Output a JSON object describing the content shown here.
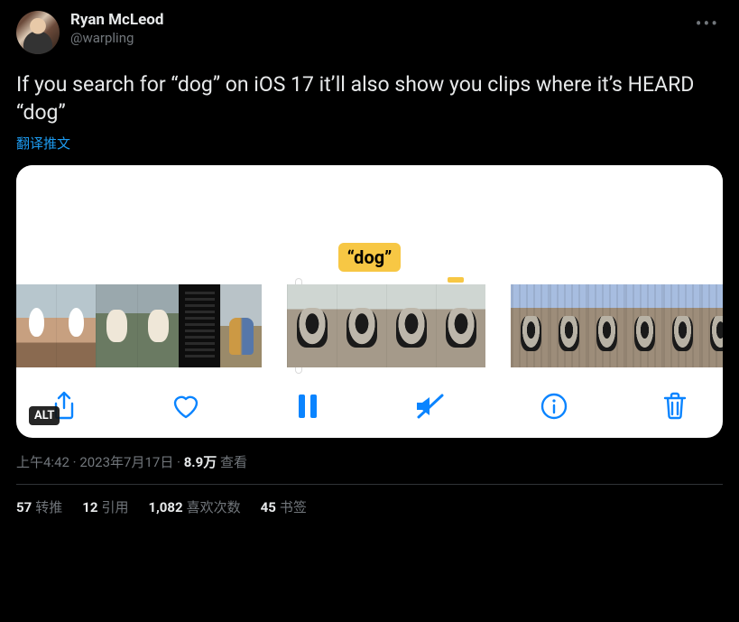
{
  "header": {
    "display_name": "Ryan McLeod",
    "handle": "@warpling"
  },
  "tweet": {
    "text": "If you search for “dog” on iOS 17 it’ll also show you clips where it’s HEARD “dog”",
    "translate_label": "翻译推文"
  },
  "media": {
    "highlight_label": "“dog”",
    "alt_badge": "ALT",
    "toolbar_icons": {
      "share": "share-icon",
      "like": "heart-icon",
      "pause": "pause-icon",
      "mute": "mute-icon",
      "info": "info-icon",
      "trash": "trash-icon"
    }
  },
  "meta": {
    "time": "上午4:42",
    "separator": " · ",
    "date": "2023年7月17日",
    "views_number": "8.9万",
    "views_label": " 查看"
  },
  "stats": {
    "retweets": {
      "num": "57",
      "label": "转推"
    },
    "quotes": {
      "num": "12",
      "label": "引用"
    },
    "likes": {
      "num": "1,082",
      "label": "喜欢次数"
    },
    "bookmarks": {
      "num": "45",
      "label": "书签"
    }
  }
}
